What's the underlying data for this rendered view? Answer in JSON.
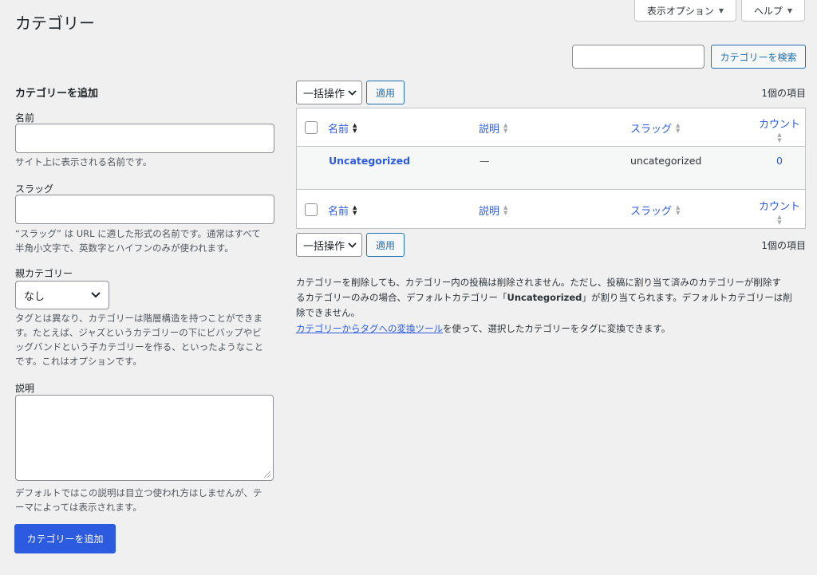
{
  "page_title": "カテゴリー",
  "screen_options": {
    "label": "表示オプション"
  },
  "help_tab": {
    "label": "ヘルプ"
  },
  "search": {
    "value": "",
    "button_label": "カテゴリーを検索"
  },
  "add_form": {
    "title": "カテゴリーを追加",
    "name": {
      "label": "名前",
      "value": "",
      "help": "サイト上に表示される名前です。"
    },
    "slug": {
      "label": "スラッグ",
      "value": "",
      "help_line1": "“スラッグ” は URL に適した形式の名前です。通常はすべて",
      "help_line2": "半角小文字で、英数字とハイフンのみが使われます。"
    },
    "parent": {
      "label": "親カテゴリー",
      "selected": "なし",
      "help_line1": "タグとは異なり、カテゴリーは階層構造を持つことができま",
      "help_line2": "す。たとえば、ジャズというカテゴリーの下にビバップやビ",
      "help_line3": "ッグバンドという子カテゴリーを作る、といったようなこと",
      "help_line4": "です。これはオプションです。"
    },
    "description": {
      "label": "説明",
      "value": "",
      "help_line1": "デフォルトではこの説明は目立つ使われ方はしませんが、テ",
      "help_line2": "ーマによっては表示されます。"
    },
    "submit_label": "カテゴリーを追加"
  },
  "bulk_actions": {
    "selected": "一括操作",
    "apply_label": "適用"
  },
  "items_count": "1個の項目",
  "table": {
    "columns": {
      "name": "名前",
      "description": "説明",
      "slug": "スラッグ",
      "count": "カウント"
    },
    "rows": [
      {
        "name": "Uncategorized",
        "description": "—",
        "slug": "uncategorized",
        "count": "0"
      }
    ]
  },
  "notes": {
    "line1": "カテゴリーを削除しても、カテゴリー内の投稿は削除されません。ただし、投稿に割り当て済みのカテゴリーが削除す",
    "line2_pre": "るカテゴリーのみの場合、デフォルトカテゴリー「",
    "line2_bold": "Uncategorized",
    "line2_post": "」が割り当てられます。デフォルトカテゴリーは削",
    "line3": "除できません。",
    "converter_link": "カテゴリーからタグへの変換ツール",
    "converter_text": "を使って、選択したカテゴリーをタグに変換できます。"
  }
}
